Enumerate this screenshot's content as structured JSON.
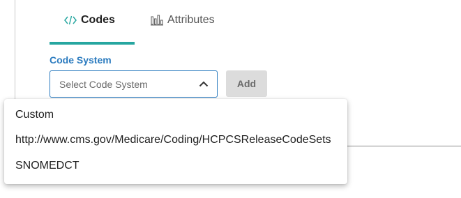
{
  "tabs": [
    {
      "label": "Codes",
      "icon": "code-icon",
      "selected": true
    },
    {
      "label": "Attributes",
      "icon": "bar-chart-icon",
      "selected": false
    }
  ],
  "colors": {
    "accent": "#26a6a0",
    "label_blue": "#2b7bbf",
    "button_bg": "#dcdcdc"
  },
  "code_system": {
    "label": "Code System",
    "placeholder": "Select Code System",
    "expanded": true,
    "options": [
      "Custom",
      "http://www.cms.gov/Medicare/Coding/HCPCSReleaseCodeSets",
      "SNOMEDCT"
    ]
  },
  "add_button": {
    "label": "Add",
    "disabled": true
  }
}
